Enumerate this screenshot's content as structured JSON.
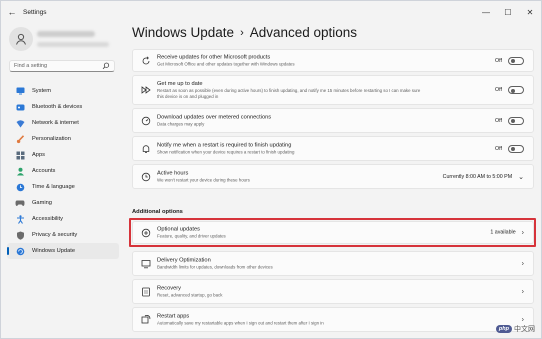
{
  "window": {
    "title": "Settings"
  },
  "sidebar": {
    "search_placeholder": "Find a setting",
    "items": [
      {
        "label": "System",
        "icon": "monitor-icon",
        "color": "#2b78d6"
      },
      {
        "label": "Bluetooth & devices",
        "icon": "bluetooth-icon",
        "color": "#2b78d6"
      },
      {
        "label": "Network & internet",
        "icon": "wifi-icon",
        "color": "#3a7bd5"
      },
      {
        "label": "Personalization",
        "icon": "brush-icon",
        "color": "#e07a3f"
      },
      {
        "label": "Apps",
        "icon": "apps-icon",
        "color": "#5a6b7d"
      },
      {
        "label": "Accounts",
        "icon": "person-icon",
        "color": "#2ea36b"
      },
      {
        "label": "Time & language",
        "icon": "globe-clock-icon",
        "color": "#2b78d6"
      },
      {
        "label": "Gaming",
        "icon": "gamepad-icon",
        "color": "#6b6b6b"
      },
      {
        "label": "Accessibility",
        "icon": "accessibility-icon",
        "color": "#2b78d6"
      },
      {
        "label": "Privacy & security",
        "icon": "shield-icon",
        "color": "#6b6b6b"
      },
      {
        "label": "Windows Update",
        "icon": "update-icon",
        "color": "#2b78d6"
      }
    ]
  },
  "header": {
    "crumb": "Windows Update",
    "separator": "›",
    "title": "Advanced options"
  },
  "cards": {
    "receive": {
      "title": "Receive updates for other Microsoft products",
      "desc": "Get Microsoft Office and other updates together with Windows updates",
      "state": "Off"
    },
    "getmeuptodate": {
      "title": "Get me up to date",
      "desc1": "Restart as soon as possible (even during active hours) to finish updating, and notify me 15 minutes before restarting so I can make sure",
      "desc2": "this device is on and plugged in",
      "state": "Off"
    },
    "metered": {
      "title": "Download updates over metered connections",
      "desc": "Data charges may apply",
      "state": "Off"
    },
    "notify": {
      "title": "Notify me when a restart is required to finish updating",
      "desc": "Show notification when your device requires a restart to finish updating",
      "state": "Off"
    },
    "activehours": {
      "title": "Active hours",
      "desc": "We won't restart your device during these hours",
      "value": "Currently 8:00 AM to 5:00 PM"
    }
  },
  "additional": {
    "label": "Additional options",
    "optional": {
      "title": "Optional updates",
      "desc": "Feature, quality, and driver updates",
      "badge": "1 available"
    },
    "delivery": {
      "title": "Delivery Optimization",
      "desc": "Bandwidth limits for updates, downloads from other devices"
    },
    "recovery": {
      "title": "Recovery",
      "desc": "Reset, advanced startup, go back"
    },
    "restartapps": {
      "title": "Restart apps",
      "desc": "Automatically save my restartable apps when I sign out and restart them after I sign in"
    }
  },
  "watermark": {
    "badge": "php",
    "text": "中文网"
  }
}
